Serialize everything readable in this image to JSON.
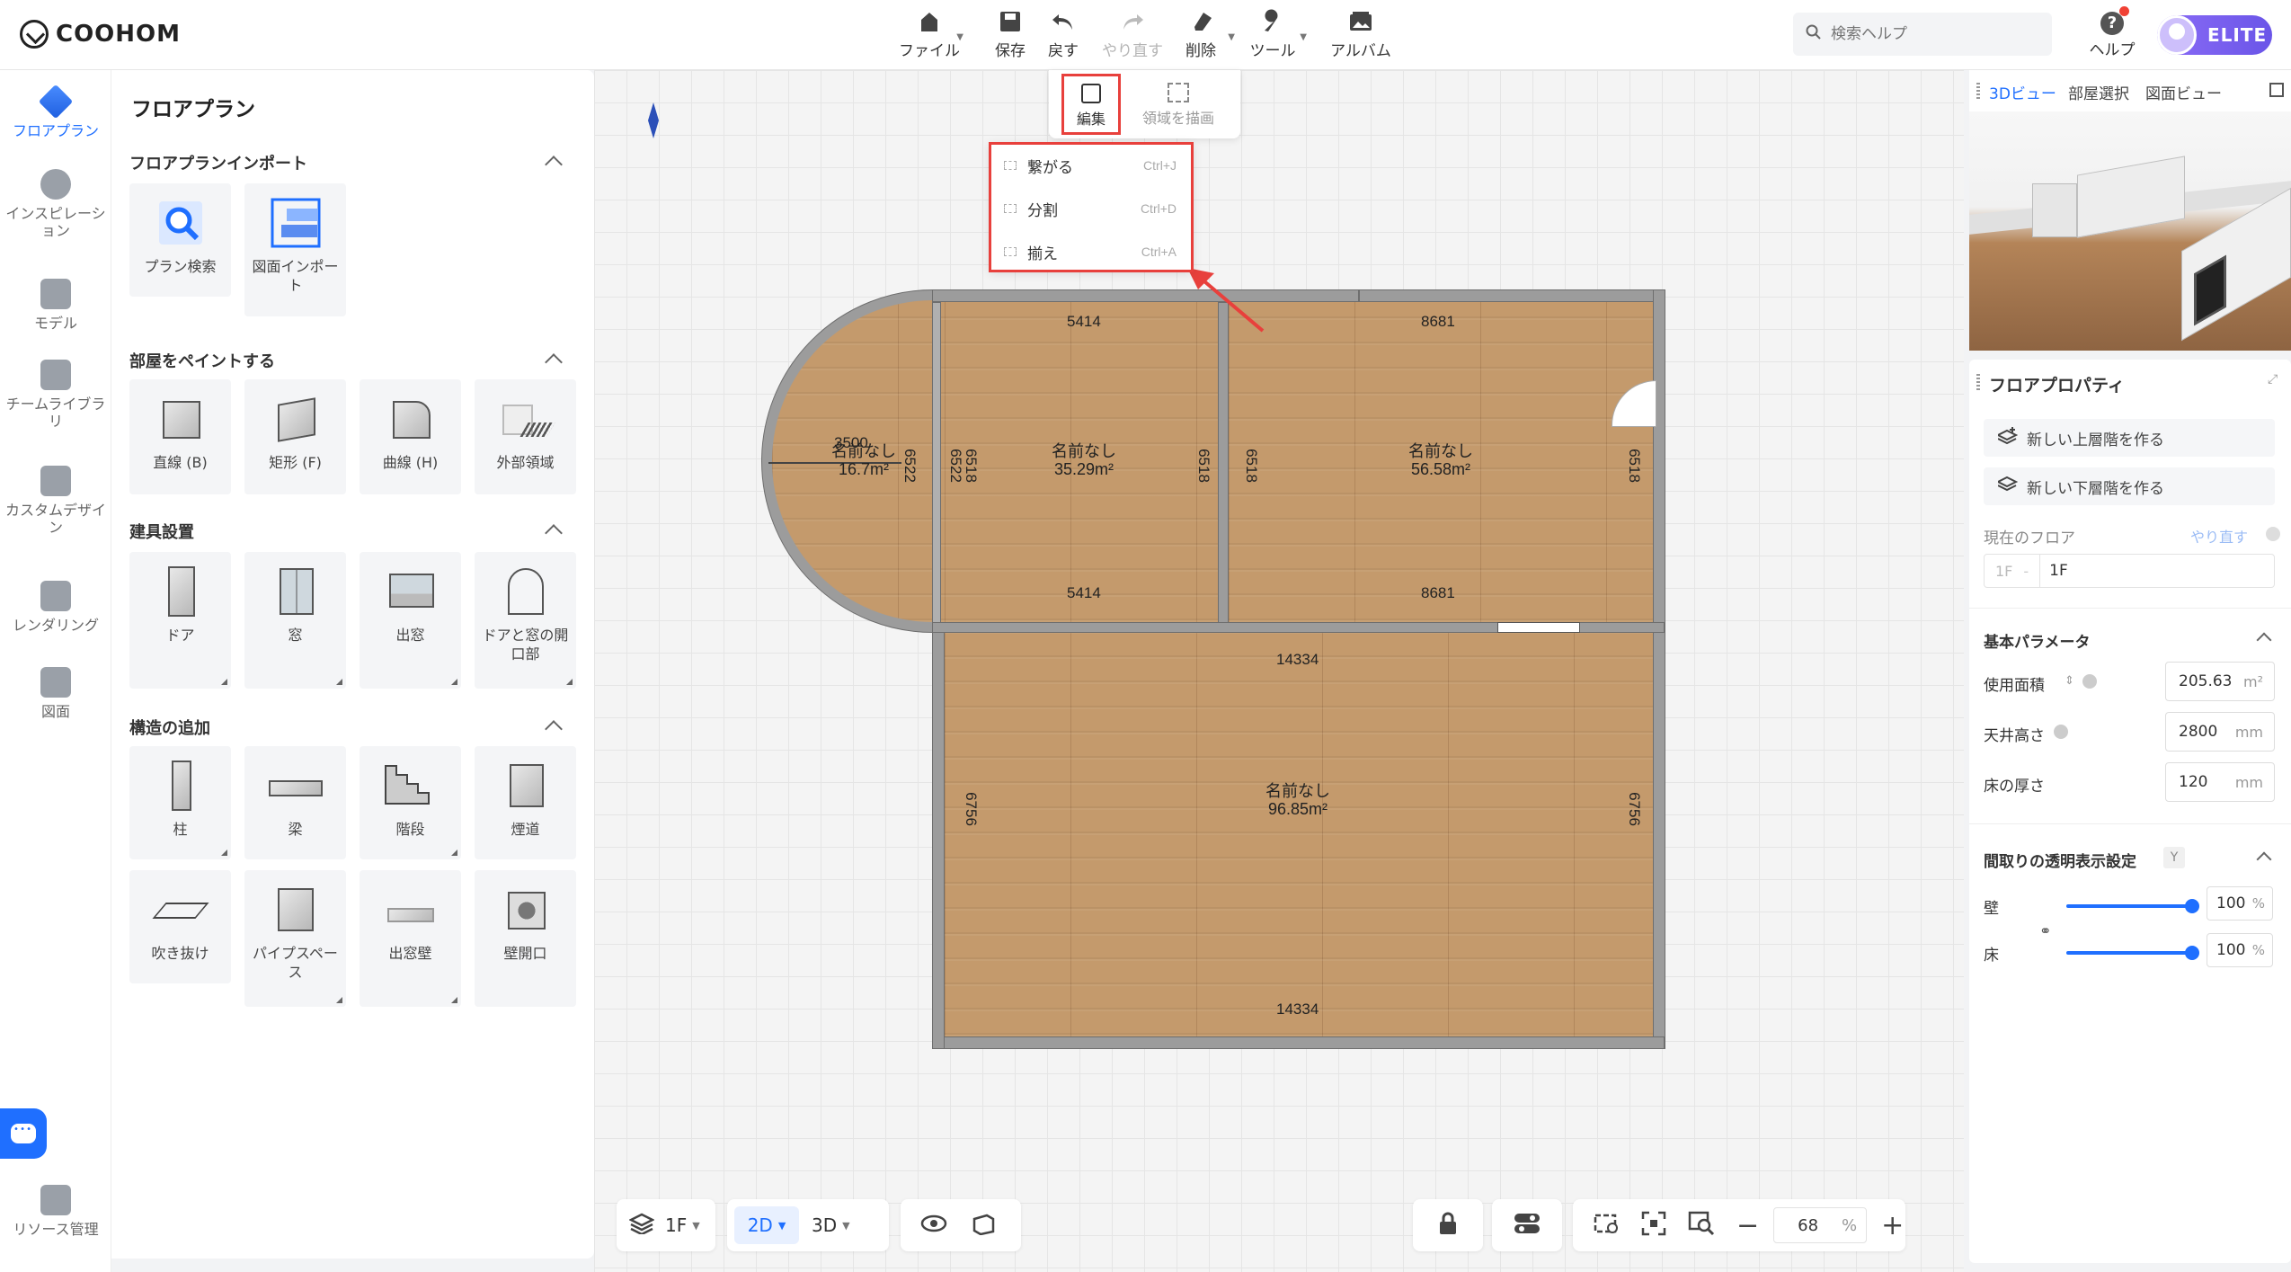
{
  "app": {
    "logo": "COOHOM"
  },
  "toolbar": {
    "file": "ファイル",
    "save": "保存",
    "undo": "戻す",
    "redo": "やり直す",
    "delete": "削除",
    "tools": "ツール",
    "album": "アルバム"
  },
  "search": {
    "placeholder": "検索ヘルプ"
  },
  "help": {
    "label": "ヘルプ"
  },
  "account": {
    "badge": "ELITE"
  },
  "rail": {
    "items": [
      {
        "label": "フロアプラン",
        "active": true
      },
      {
        "label": "インスピレーション"
      },
      {
        "label": "モデル"
      },
      {
        "label": "チームライブラリ"
      },
      {
        "label": "カスタムデザイン"
      },
      {
        "label": "レンダリング"
      },
      {
        "label": "図面"
      }
    ],
    "resource": "リソース管理"
  },
  "panel": {
    "title": "フロアプラン",
    "import": {
      "title": "フロアプランインポート",
      "items": [
        "プラン検索",
        "図面インポート"
      ]
    },
    "paint": {
      "title": "部屋をペイントする",
      "items": [
        "直線 (B)",
        "矩形 (F)",
        "曲線 (H)",
        "外部領域"
      ]
    },
    "fixtures": {
      "title": "建具設置",
      "items": [
        "ドア",
        "窓",
        "出窓",
        "ドアと窓の開口部"
      ]
    },
    "structure": {
      "title": "構造の追加",
      "items": [
        "柱",
        "梁",
        "階段",
        "煙道",
        "吹き抜け",
        "パイプスペース",
        "出窓壁",
        "壁開口"
      ]
    }
  },
  "edit_toolbar": {
    "edit": "編集",
    "draw_area": "領域を描画"
  },
  "edit_menu": [
    {
      "label": "繋がる",
      "shortcut": "Ctrl+J"
    },
    {
      "label": "分割",
      "shortcut": "Ctrl+D"
    },
    {
      "label": "揃え",
      "shortcut": "Ctrl+A"
    }
  ],
  "floorplan": {
    "rooms": [
      {
        "name": "名前なし",
        "area": "16.7m²"
      },
      {
        "name": "名前なし",
        "area": "35.29m²"
      },
      {
        "name": "名前なし",
        "area": "56.58m²"
      },
      {
        "name": "名前なし",
        "area": "96.85m²"
      }
    ],
    "dims": {
      "r1_radius": "3500",
      "r1_h": "6522",
      "r2_top": "5414",
      "r2_bottom": "5414",
      "r2_left": "6522",
      "r2_left2": "6518",
      "r2_right": "6518",
      "r3_top": "8681",
      "r3_bottom": "8681",
      "r3_left": "6518",
      "r3_right": "6518",
      "r4_top": "14334",
      "r4_bottom": "14334",
      "r4_left": "6756",
      "r4_right": "6756"
    }
  },
  "bottom": {
    "floor": "1F",
    "mode2d": "2D",
    "mode3d": "3D",
    "zoom": "68",
    "zoom_unit": "%"
  },
  "right": {
    "tabs": [
      "3Dビュー",
      "部屋選択",
      "図面ビュー"
    ],
    "props_title": "フロアプロパティ",
    "new_upper": "新しい上層階を作る",
    "new_lower": "新しい下層階を作る",
    "current_floor": "現在のフロア",
    "redo": "やり直す",
    "floor_prefix": "1F",
    "floor_name": "1F",
    "basic": "基本パラメータ",
    "area_label": "使用面積",
    "area_value": "205.63",
    "area_unit": "m²",
    "ceiling_label": "天井高さ",
    "ceiling_value": "2800",
    "ceiling_unit": "mm",
    "floor_thick_label": "床の厚さ",
    "floor_thick_value": "120",
    "floor_thick_unit": "mm",
    "transparency": "間取りの透明表示設定",
    "transparency_key": "Y",
    "wall": "壁",
    "wall_value": "100",
    "floor": "床",
    "floor_value": "100",
    "pct": "%",
    "wall_opacity": 1.0,
    "floor_opacity": 1.0
  }
}
